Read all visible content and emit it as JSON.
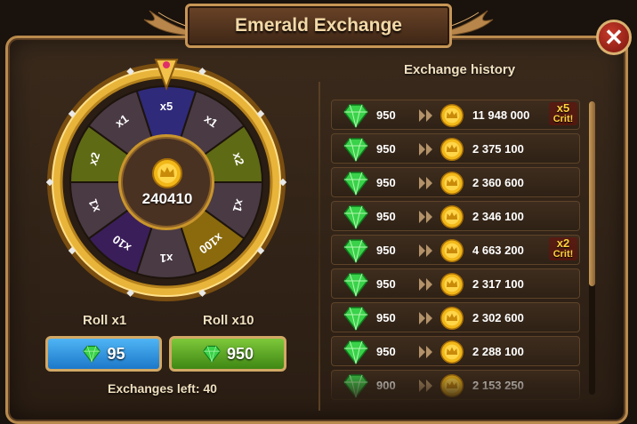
{
  "title": "Emerald Exchange",
  "close_icon": "close-icon",
  "wheel": {
    "center_value": "240410",
    "segments": [
      "x5",
      "x1",
      "x2",
      "x1",
      "x100",
      "x1",
      "x10",
      "x1",
      "x2",
      "x1"
    ]
  },
  "roll": {
    "x1_label": "Roll x1",
    "x10_label": "Roll x10",
    "x1_cost": "95",
    "x10_cost": "950"
  },
  "exchanges_left": "Exchanges left: 40",
  "history": {
    "title": "Exchange history",
    "rows": [
      {
        "emeralds": "950",
        "gold": "11 948 000",
        "crit": "x5",
        "crit_label": "Crit!"
      },
      {
        "emeralds": "950",
        "gold": "2 375 100"
      },
      {
        "emeralds": "950",
        "gold": "2 360 600"
      },
      {
        "emeralds": "950",
        "gold": "2 346 100"
      },
      {
        "emeralds": "950",
        "gold": "4 663 200",
        "crit": "x2",
        "crit_label": "Crit!"
      },
      {
        "emeralds": "950",
        "gold": "2 317 100"
      },
      {
        "emeralds": "950",
        "gold": "2 302 600"
      },
      {
        "emeralds": "950",
        "gold": "2 288 100"
      },
      {
        "emeralds": "900",
        "gold": "2 153 250"
      }
    ]
  },
  "colors": {
    "accent": "#c79656",
    "emerald": "#39d24a",
    "gold": "#f2b818",
    "crit": "#ffd23c"
  }
}
